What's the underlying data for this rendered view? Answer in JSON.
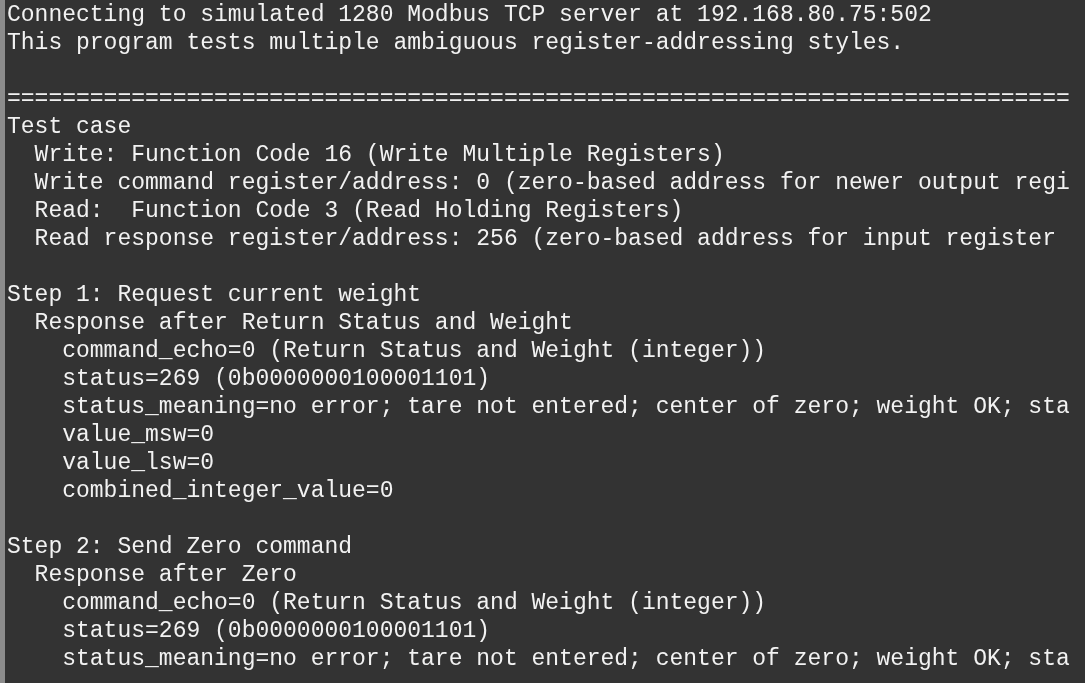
{
  "terminal": {
    "lines": [
      {
        "kind": "text",
        "text": "Connecting to simulated 1280 Modbus TCP server at 192.168.80.75:502"
      },
      {
        "kind": "text",
        "text": "This program tests multiple ambiguous register-addressing styles."
      },
      {
        "kind": "blank"
      },
      {
        "kind": "text",
        "text": "============================================================================="
      },
      {
        "kind": "text",
        "text": "Test case"
      },
      {
        "kind": "text",
        "text": "  Write: Function Code 16 (Write Multiple Registers)"
      },
      {
        "kind": "text",
        "text": "  Write command register/address: 0 (zero-based address for newer output regi"
      },
      {
        "kind": "text",
        "text": "  Read:  Function Code 3 (Read Holding Registers)"
      },
      {
        "kind": "text",
        "text": "  Read response register/address: 256 (zero-based address for input register"
      },
      {
        "kind": "blank"
      },
      {
        "kind": "text",
        "text": "Step 1: Request current weight"
      },
      {
        "kind": "text",
        "text": "  Response after Return Status and Weight"
      },
      {
        "kind": "text",
        "text": "    command_echo=0 (Return Status and Weight (integer))"
      },
      {
        "kind": "text",
        "text": "    status=269 (0b0000000100001101)"
      },
      {
        "kind": "text",
        "text": "    status_meaning=no error; tare not entered; center of zero; weight OK; sta"
      },
      {
        "kind": "text",
        "text": "    value_msw=0"
      },
      {
        "kind": "text",
        "text": "    value_lsw=0"
      },
      {
        "kind": "text",
        "text": "    combined_integer_value=0"
      },
      {
        "kind": "blank"
      },
      {
        "kind": "text",
        "text": "Step 2: Send Zero command"
      },
      {
        "kind": "text",
        "text": "  Response after Zero"
      },
      {
        "kind": "text",
        "text": "    command_echo=0 (Return Status and Weight (integer))"
      },
      {
        "kind": "text",
        "text": "    status=269 (0b0000000100001101)"
      },
      {
        "kind": "text",
        "text": "    status_meaning=no error; tare not entered; center of zero; weight OK; sta"
      }
    ]
  }
}
